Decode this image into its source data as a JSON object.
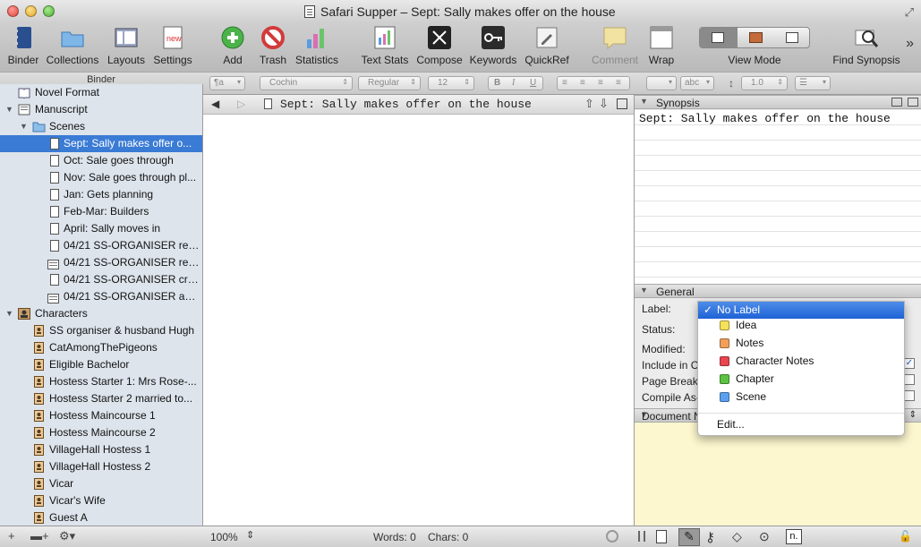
{
  "window": {
    "title": "Safari Supper – Sept: Sally makes offer on the house"
  },
  "toolbar": {
    "items": [
      {
        "label": "Binder",
        "icon": "binder-icon"
      },
      {
        "label": "Collections",
        "icon": "collections-icon"
      },
      {
        "label": "Layouts",
        "icon": "layouts-icon"
      },
      {
        "label": "Settings",
        "icon": "settings-icon"
      },
      {
        "label": "Add",
        "icon": "add-icon"
      },
      {
        "label": "Trash",
        "icon": "trash-icon"
      },
      {
        "label": "Statistics",
        "icon": "statistics-icon"
      },
      {
        "label": "Text Stats",
        "icon": "text-stats-icon"
      },
      {
        "label": "Compose",
        "icon": "compose-icon"
      },
      {
        "label": "Keywords",
        "icon": "keywords-icon"
      },
      {
        "label": "QuickRef",
        "icon": "quickref-icon"
      },
      {
        "label": "Comment",
        "icon": "comment-icon"
      },
      {
        "label": "Wrap",
        "icon": "wrap-icon"
      },
      {
        "label": "View Mode",
        "icon": "view-mode-icon"
      },
      {
        "label": "Find Synopsis",
        "icon": "find-synopsis-icon"
      }
    ]
  },
  "formatbar": {
    "binder_header": "Binder",
    "style": "¶a",
    "font": "Cochin",
    "weight": "Regular",
    "size": "12",
    "bold": "B",
    "italic": "I",
    "underline": "U",
    "highlight": "abc",
    "line_spacing": "1.0"
  },
  "binder": {
    "items": [
      {
        "label": "Novel Format",
        "level": 0,
        "icon": "book-icon"
      },
      {
        "label": "Manuscript",
        "level": 0,
        "icon": "manuscript-icon",
        "expanded": true
      },
      {
        "label": "Scenes",
        "level": 1,
        "icon": "folder-icon",
        "expanded": true
      },
      {
        "label": "Sept: Sally makes offer o...",
        "level": 2,
        "icon": "document-icon",
        "selected": true
      },
      {
        "label": "Oct: Sale goes through",
        "level": 2,
        "icon": "document-icon"
      },
      {
        "label": "Nov: Sale goes through pl...",
        "level": 2,
        "icon": "document-icon"
      },
      {
        "label": "Jan: Gets planning",
        "level": 2,
        "icon": "document-icon"
      },
      {
        "label": "Feb-Mar: Builders",
        "level": 2,
        "icon": "document-icon"
      },
      {
        "label": "April: Sally moves in",
        "level": 2,
        "icon": "document-icon"
      },
      {
        "label": "04/21 SS-ORGANISER retr...",
        "level": 2,
        "icon": "document-icon"
      },
      {
        "label": "04/21 SS-ORGANISER revi...",
        "level": 2,
        "icon": "text-document-icon"
      },
      {
        "label": "04/21 SS-ORGANISER cro...",
        "level": 2,
        "icon": "document-icon"
      },
      {
        "label": "04/21 SS-ORGANISER and...",
        "level": 2,
        "icon": "text-document-icon"
      },
      {
        "label": "Characters",
        "level": 0,
        "icon": "characters-folder-icon",
        "expanded": true
      },
      {
        "label": "SS organiser & husband Hugh",
        "level": 1,
        "icon": "character-sheet-icon"
      },
      {
        "label": "CatAmongThePigeons",
        "level": 1,
        "icon": "character-sheet-icon"
      },
      {
        "label": "Eligible Bachelor",
        "level": 1,
        "icon": "character-sheet-icon"
      },
      {
        "label": "Hostess Starter 1: Mrs Rose-...",
        "level": 1,
        "icon": "character-sheet-icon"
      },
      {
        "label": "Hostess Starter 2 married to...",
        "level": 1,
        "icon": "character-sheet-icon"
      },
      {
        "label": "Hostess Maincourse 1",
        "level": 1,
        "icon": "character-sheet-icon"
      },
      {
        "label": "Hostess Maincourse 2",
        "level": 1,
        "icon": "character-sheet-icon"
      },
      {
        "label": "VillageHall Hostess 1",
        "level": 1,
        "icon": "character-sheet-icon"
      },
      {
        "label": "VillageHall Hostess 2",
        "level": 1,
        "icon": "character-sheet-icon"
      },
      {
        "label": "Vicar",
        "level": 1,
        "icon": "character-sheet-icon"
      },
      {
        "label": "Vicar's Wife",
        "level": 1,
        "icon": "character-sheet-icon"
      },
      {
        "label": "Guest A",
        "level": 1,
        "icon": "character-sheet-icon"
      }
    ]
  },
  "editor": {
    "doc_title": "Sept: Sally makes offer on the house",
    "zoom": "100%",
    "words": "Words: 0",
    "chars": "Chars: 0"
  },
  "inspector": {
    "synopsis_header": "Synopsis",
    "synopsis_text": "Sept: Sally makes offer on the house",
    "general_header": "General",
    "fields": {
      "label": "Label:",
      "status": "Status:",
      "modified": "Modified:",
      "include": "Include in C",
      "page_break": "Page Break",
      "compile_as": "Compile As-"
    },
    "document_notes_header": "Document N",
    "n_button": "n."
  },
  "label_menu": {
    "selected": "No Label",
    "options": [
      {
        "name": "Idea",
        "color": "#f5e15a"
      },
      {
        "name": "Notes",
        "color": "#f0a05a"
      },
      {
        "name": "Character Notes",
        "color": "#e8454f"
      },
      {
        "name": "Chapter",
        "color": "#5cc242"
      },
      {
        "name": "Scene",
        "color": "#5ba0ee"
      }
    ],
    "edit": "Edit..."
  }
}
